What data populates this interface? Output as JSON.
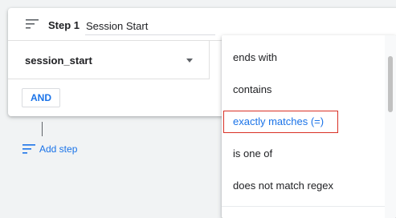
{
  "step": {
    "label": "Step 1",
    "name_value": "Session Start"
  },
  "event": {
    "value": "session_start"
  },
  "and_button": {
    "label": "AND"
  },
  "add_step": {
    "label": "Add step"
  },
  "match_menu": {
    "items": [
      {
        "label": "ends with"
      },
      {
        "label": "contains"
      },
      {
        "label": "exactly matches (=)"
      },
      {
        "label": "is one of"
      },
      {
        "label": "does not match regex"
      }
    ],
    "highlighted": "exactly matches (=)"
  },
  "colors": {
    "accent": "#1a73e8",
    "focus_outline": "#d93025",
    "background": "#f1f3f4"
  }
}
